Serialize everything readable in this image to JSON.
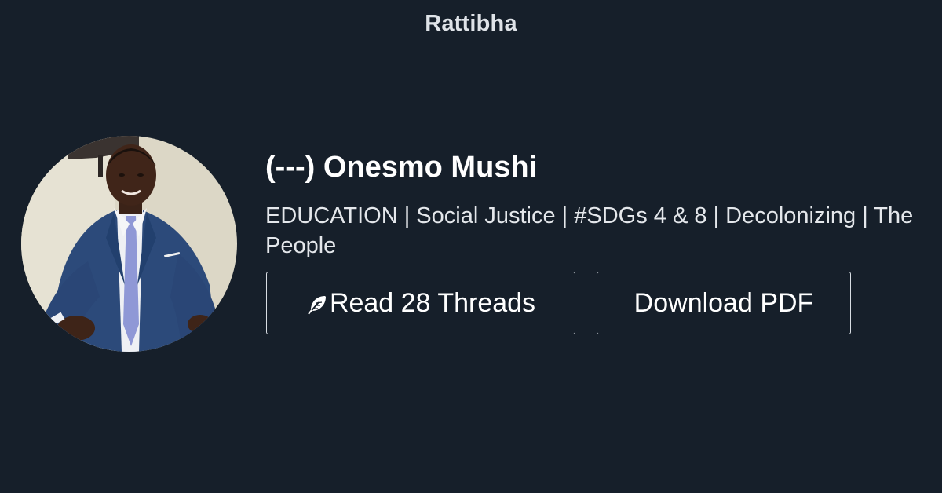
{
  "header": {
    "brand": "Rattibha"
  },
  "profile": {
    "avatar_icon": "profile-photo",
    "name": "(---) Onesmo Mushi",
    "bio": "EDUCATION | Social Justice | #SDGs 4 & 8 | Decolonizing | The People"
  },
  "actions": {
    "read_label": "Read 28 Threads",
    "read_icon": "feather-icon",
    "download_label": "Download PDF"
  },
  "colors": {
    "background": "#161f2a",
    "text": "#ffffff",
    "border": "#d8dde3"
  }
}
